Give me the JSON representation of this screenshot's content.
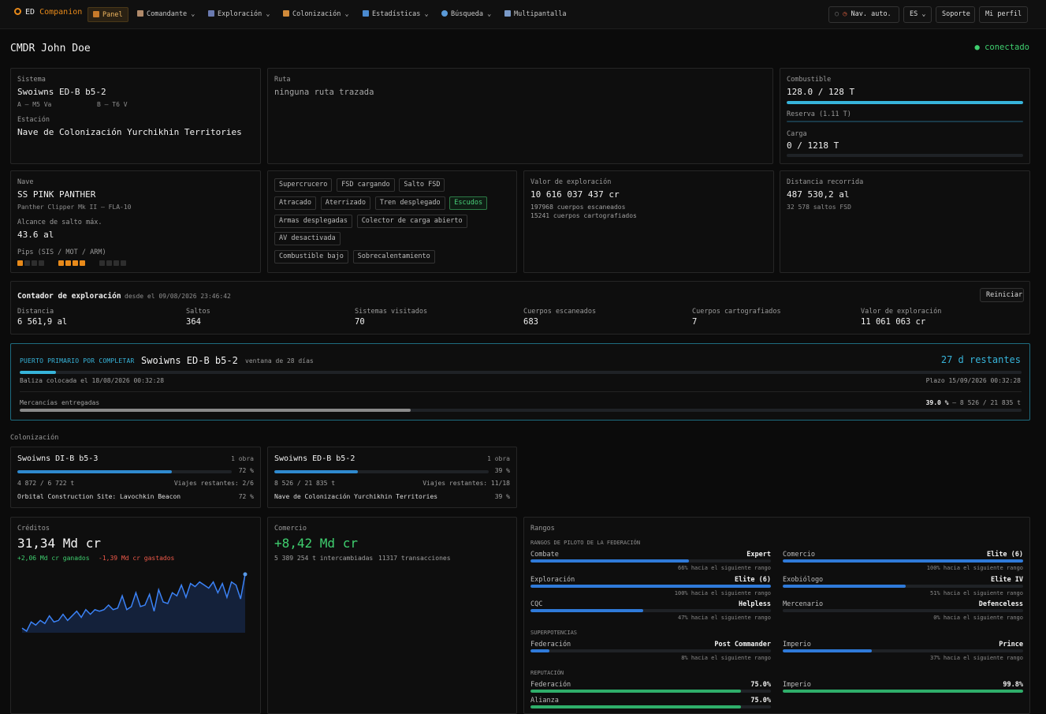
{
  "brand": {
    "prefix": "ED",
    "name": "Companion"
  },
  "nav": [
    "Panel",
    "Comandante",
    "Exploración",
    "Colonización",
    "Estadísticas",
    "Búsqueda",
    "Multipantalla"
  ],
  "navbtns": {
    "auto": "Nav. auto.",
    "lang": "ES",
    "support": "Soporte",
    "profile": "Mi perfil"
  },
  "header": {
    "cmdr": "CMDR John Doe",
    "status": "conectado"
  },
  "system": {
    "label": "Sistema",
    "name": "Swoiwns ED-B b5-2",
    "starA": "A — M5 Va",
    "starB": "B — T6 V",
    "station_label": "Estación",
    "station": "Nave de Colonización Yurchikhin Territories"
  },
  "route": {
    "label": "Ruta",
    "value": "ninguna ruta trazada"
  },
  "fuel": {
    "label": "Combustible",
    "value": "128.0 / 128 T",
    "fuel_frac": 1.0,
    "reserve": "Reserva (1.11 T)",
    "cargo_label": "Carga",
    "cargo": "0 / 1218 T",
    "cargo_frac": 0.0
  },
  "ship": {
    "label": "Nave",
    "name": "SS PINK PANTHER",
    "model": "Panther Clipper Mk II — FLA-10",
    "jump_label": "Alcance de salto máx.",
    "jump": "43.6 al",
    "pips_label": "Pips (SIS / MOT / ARM)",
    "pips": [
      1,
      4,
      0
    ]
  },
  "status_tags": [
    {
      "t": "Supercrucero",
      "on": false
    },
    {
      "t": "FSD cargando",
      "on": false
    },
    {
      "t": "Salto FSD",
      "on": false
    },
    {
      "t": "Atracado",
      "on": false
    },
    {
      "t": "Aterrizado",
      "on": false
    },
    {
      "t": "Tren desplegado",
      "on": false
    },
    {
      "t": "Escudos",
      "on": true
    },
    {
      "t": "Armas desplegadas",
      "on": false
    },
    {
      "t": "Colector de carga abierto",
      "on": false
    },
    {
      "t": "AV desactivada",
      "on": false
    },
    {
      "t": "Combustible bajo",
      "on": false
    },
    {
      "t": "Sobrecalentamiento",
      "on": false
    }
  ],
  "exploration_value": {
    "label": "Valor de exploración",
    "value": "10 616 037 437 cr",
    "scanned": "197968 cuerpos escaneados",
    "mapped": "15241 cuerpos cartografiados"
  },
  "distance": {
    "label": "Distancia recorrida",
    "value": "487 530,2 al",
    "jumps": "32 578 saltos FSD"
  },
  "counter": {
    "title": "Contador de exploración",
    "since": "desde el 09/08/2026 23:46:42",
    "reset": "Reiniciar",
    "stats": [
      {
        "l": "Distancia",
        "v": "6 561,9 al"
      },
      {
        "l": "Saltos",
        "v": "364"
      },
      {
        "l": "Sistemas visitados",
        "v": "70"
      },
      {
        "l": "Cuerpos escaneados",
        "v": "683"
      },
      {
        "l": "Cuerpos cartografiados",
        "v": "7"
      },
      {
        "l": "Valor de exploración",
        "v": "11 061 063 cr"
      }
    ]
  },
  "port": {
    "badge": "PUERTO PRIMARIO POR COMPLETAR",
    "system": "Swoiwns ED-B b5-2",
    "window": "ventana de 28 días",
    "remaining": "27 d restantes",
    "time_frac": 0.036,
    "beacon": "Baliza colocada el 18/08/2026 00:32:28",
    "deadline": "Plazo 15/09/2026 00:32:28",
    "goods_label": "Mercancías entregadas",
    "goods_pct": "39.0 %",
    "goods_detail": "— 8 526 / 21 835 t",
    "goods_frac": 0.39
  },
  "colonization": {
    "label": "Colonización",
    "items": [
      {
        "name": "Swoiwns DI-B b5-3",
        "works": "1 obra",
        "pct": "72 %",
        "frac": 0.72,
        "tons": "4 872 / 6 722 t",
        "trips": "Viajes restantes: 2/6",
        "site": "Orbital Construction Site: Lavochkin Beacon",
        "site_pct": "72 %"
      },
      {
        "name": "Swoiwns ED-B b5-2",
        "works": "1 obra",
        "pct": "39 %",
        "frac": 0.39,
        "tons": "8 526 / 21 835 t",
        "trips": "Viajes restantes: 11/18",
        "site": "Nave de Colonización Yurchikhin Territories",
        "site_pct": "39 %"
      }
    ]
  },
  "credits": {
    "label": "Créditos",
    "value": "31,34 Md cr",
    "earned": "+2,06 Md cr ganados",
    "spent": "-1,39 Md cr gastados"
  },
  "commerce": {
    "label": "Comercio",
    "value": "+8,42 Md cr",
    "traded": "5 389 254 t intercambiadas",
    "tx": "11317 transacciones"
  },
  "ranks": {
    "label": "Rangos",
    "fed_title": "RANGOS DE PILOTO DE LA FEDERACIÓN",
    "pilot": [
      {
        "n": "Combate",
        "v": "Expert",
        "s": "66% hacia el siguiente rango",
        "f": 0.66
      },
      {
        "n": "Comercio",
        "v": "Elite (6)",
        "s": "100% hacia el siguiente rango",
        "f": 1.0
      },
      {
        "n": "Exploración",
        "v": "Elite (6)",
        "s": "100% hacia el siguiente rango",
        "f": 1.0
      },
      {
        "n": "Exobiólogo",
        "v": "Elite IV",
        "s": "51% hacia el siguiente rango",
        "f": 0.51
      },
      {
        "n": "CQC",
        "v": "Helpless",
        "s": "47% hacia el siguiente rango",
        "f": 0.47
      },
      {
        "n": "Mercenario",
        "v": "Defenceless",
        "s": "0% hacia el siguiente rango",
        "f": 0.0
      }
    ],
    "sp_title": "SUPERPOTENCIAS",
    "superpowers": [
      {
        "n": "Federación",
        "v": "Post Commander",
        "s": "8% hacia el siguiente rango",
        "f": 0.08
      },
      {
        "n": "Imperio",
        "v": "Prince",
        "s": "37% hacia el siguiente rango",
        "f": 0.37
      }
    ],
    "rep_title": "REPUTACIÓN",
    "reputation": [
      {
        "n": "Federación",
        "v": "75.0%",
        "f": 0.875
      },
      {
        "n": "Imperio",
        "v": "99.8%",
        "f": 0.999
      },
      {
        "n": "Alianza",
        "v": "75.0%",
        "f": 0.875
      }
    ]
  },
  "chart_data": {
    "type": "area",
    "x": [],
    "y": [
      6,
      2,
      14,
      10,
      16,
      12,
      22,
      14,
      16,
      24,
      16,
      22,
      28,
      20,
      30,
      24,
      30,
      28,
      30,
      36,
      30,
      32,
      48,
      30,
      34,
      52,
      34,
      36,
      50,
      28,
      56,
      40,
      38,
      52,
      48,
      62,
      46,
      64,
      60,
      66,
      62,
      58,
      66,
      52,
      64,
      46,
      66,
      62,
      44,
      76
    ],
    "color": "#3b82f6"
  },
  "colors": {
    "accent": "#e88a1a",
    "green": "#3fcf6f",
    "blue": "#2f7ad9",
    "cyan": "#37b4da",
    "red": "#f05a4a"
  }
}
